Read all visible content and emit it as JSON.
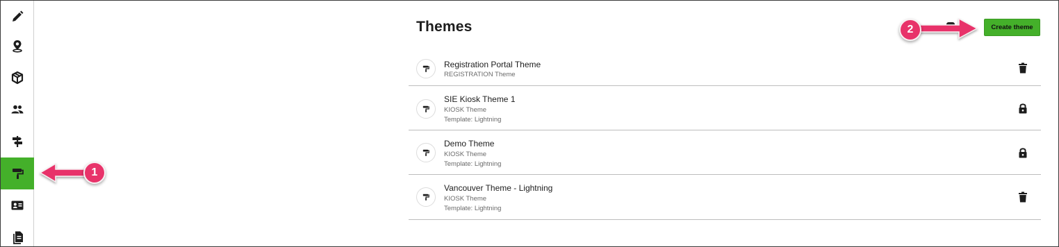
{
  "sidebar": {
    "items": [
      {
        "icon": "pencil-icon"
      },
      {
        "icon": "location-pin-icon"
      },
      {
        "icon": "package-box-icon"
      },
      {
        "icon": "people-icon"
      },
      {
        "icon": "signpost-icon"
      },
      {
        "icon": "paint-roller-icon",
        "active": true
      },
      {
        "icon": "contact-card-icon"
      },
      {
        "icon": "documents-icon"
      }
    ]
  },
  "header": {
    "title": "Themes",
    "create_label": "Create theme"
  },
  "themes": [
    {
      "name": "Registration Portal Theme",
      "type": "REGISTRATION Theme",
      "template": "",
      "action": "trash-icon"
    },
    {
      "name": "SIE Kiosk Theme 1",
      "type": "KIOSK Theme",
      "template": "Template: Lightning",
      "action": "lock-icon"
    },
    {
      "name": "Demo Theme",
      "type": "KIOSK Theme",
      "template": "Template: Lightning",
      "action": "lock-icon"
    },
    {
      "name": "Vancouver Theme - Lightning",
      "type": "KIOSK Theme",
      "template": "Template: Lightning",
      "action": "trash-icon"
    }
  ],
  "annotations": {
    "step1": "1",
    "step2": "2"
  },
  "colors": {
    "accent_green": "#44b02a",
    "callout_pink": "#e8336a"
  }
}
